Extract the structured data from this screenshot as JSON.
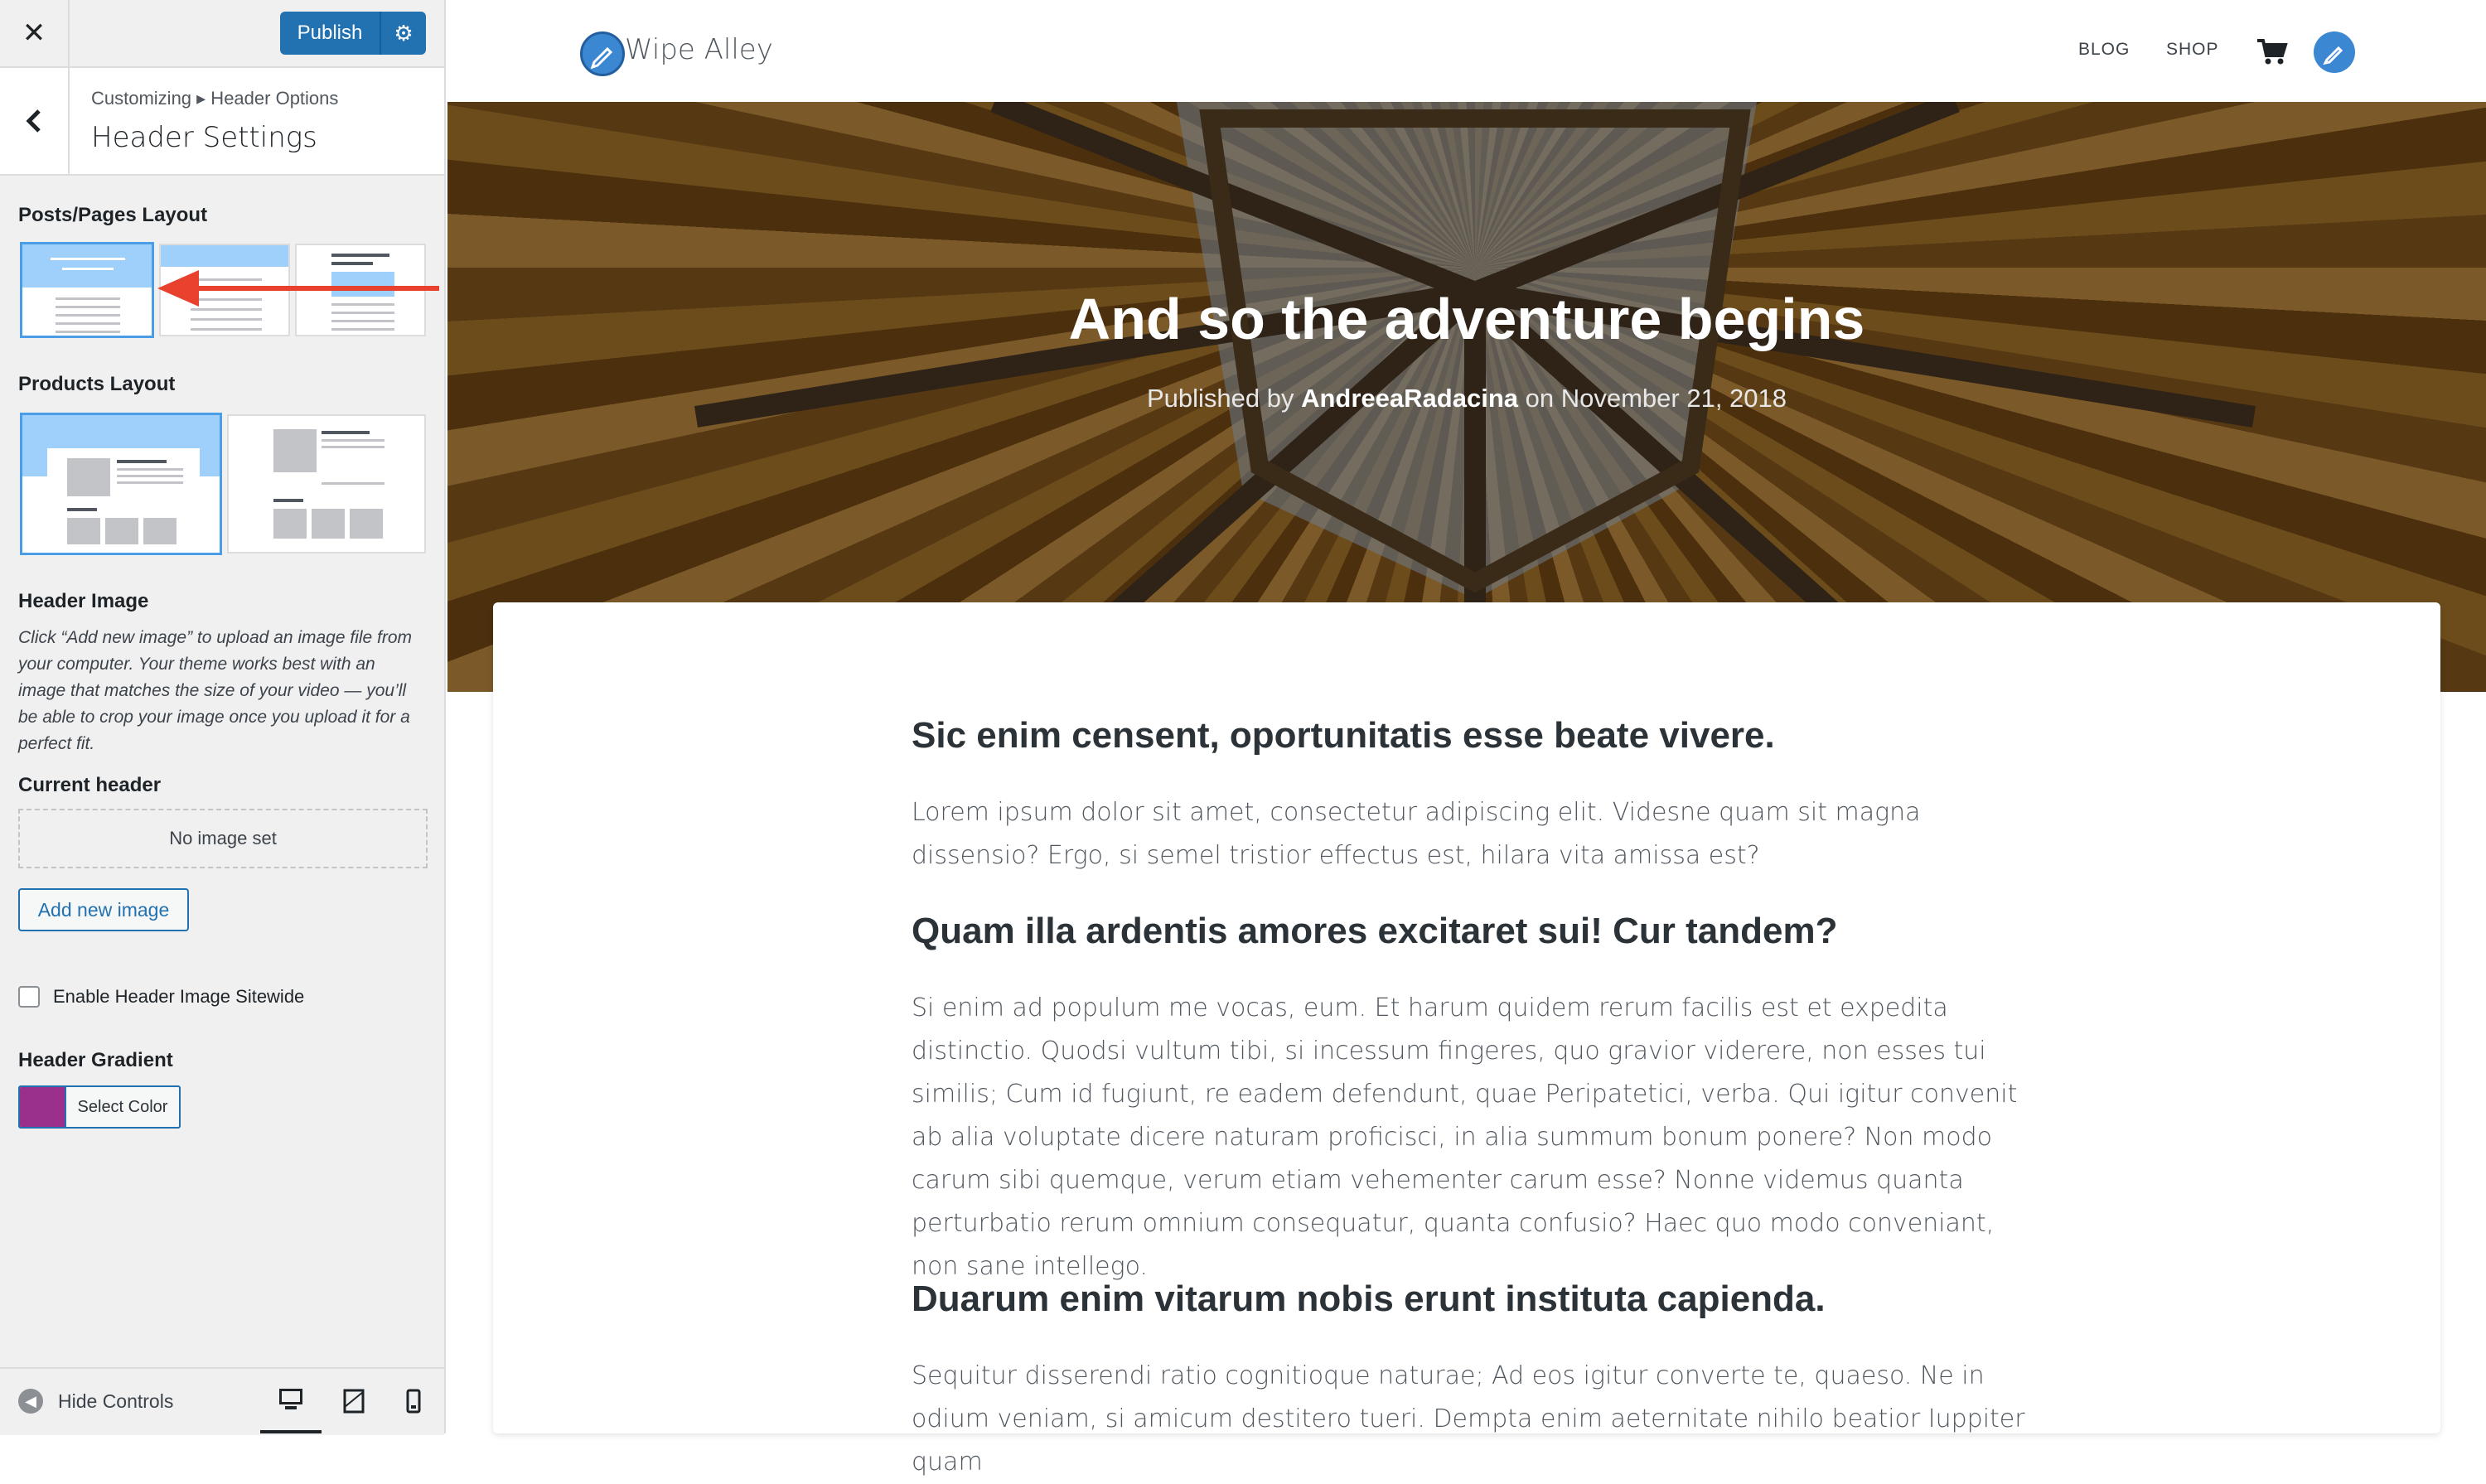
{
  "customizer": {
    "publish_label": "Publish",
    "breadcrumb": "Customizing ▸ Header Options",
    "section_title": "Header Settings",
    "posts_layout_title": "Posts/Pages Layout",
    "products_layout_title": "Products Layout",
    "header_image_title": "Header Image",
    "header_image_description": "Click “Add new image” to upload an image file from your computer. Your theme works best with an image that matches the size of your video — you’ll be able to crop your image once you upload it for a perfect fit.",
    "current_header_label": "Current header",
    "no_image_text": "No image set",
    "add_image_label": "Add new image",
    "sitewide_label": "Enable Header Image Sitewide",
    "sitewide_checked": false,
    "gradient_title": "Header Gradient",
    "select_color_label": "Select Color",
    "gradient_color": "#9b2f8c",
    "hide_controls_label": "Hide Controls",
    "active_device": "desktop",
    "annotation_arrow_color": "#e8412e"
  },
  "site": {
    "name": "Wipe Alley",
    "nav": [
      "BLOG",
      "SHOP"
    ],
    "cart_icon": "cart-icon",
    "accent": "#3b87d1"
  },
  "post": {
    "title": "And so the adventure begins",
    "meta_prefix": "Published by",
    "author": "AndreeaRadacina",
    "meta_mid": "on",
    "date": "November 21, 2018",
    "sections": [
      {
        "heading": "Sic enim censent, oportunitatis esse beate vivere.",
        "text": "Lorem ipsum dolor sit amet, consectetur adipiscing elit. Videsne quam sit magna dissensio? Ergo, si semel tristior effectus est, hilara vita amissa est?"
      },
      {
        "heading": "Quam illa ardentis amores excitaret sui! Cur tandem?",
        "text": "Si enim ad populum me vocas, eum. Et harum quidem rerum facilis est et expedita distinctio. Quodsi vultum tibi, si incessum fingeres, quo gravior viderere, non esses tui similis; Cum id fugiunt, re eadem defendunt, quae Peripatetici, verba. Qui igitur convenit ab alia voluptate dicere naturam proficisci, in alia summum bonum ponere? Non modo carum sibi quemque, verum etiam vehementer carum esse? Nonne videmus quanta perturbatio rerum omnium consequatur, quanta confusio? Haec quo modo conveniant, non sane intellego."
      },
      {
        "heading": "Duarum enim vitarum nobis erunt instituta capienda.",
        "text": "Sequitur disserendi ratio cognitioque naturae; Ad eos igitur converte te, quaeso. Ne in odium veniam, si amicum destitero tueri. Dempta enim aeternitate nihilo beatior Iuppiter quam"
      }
    ]
  }
}
